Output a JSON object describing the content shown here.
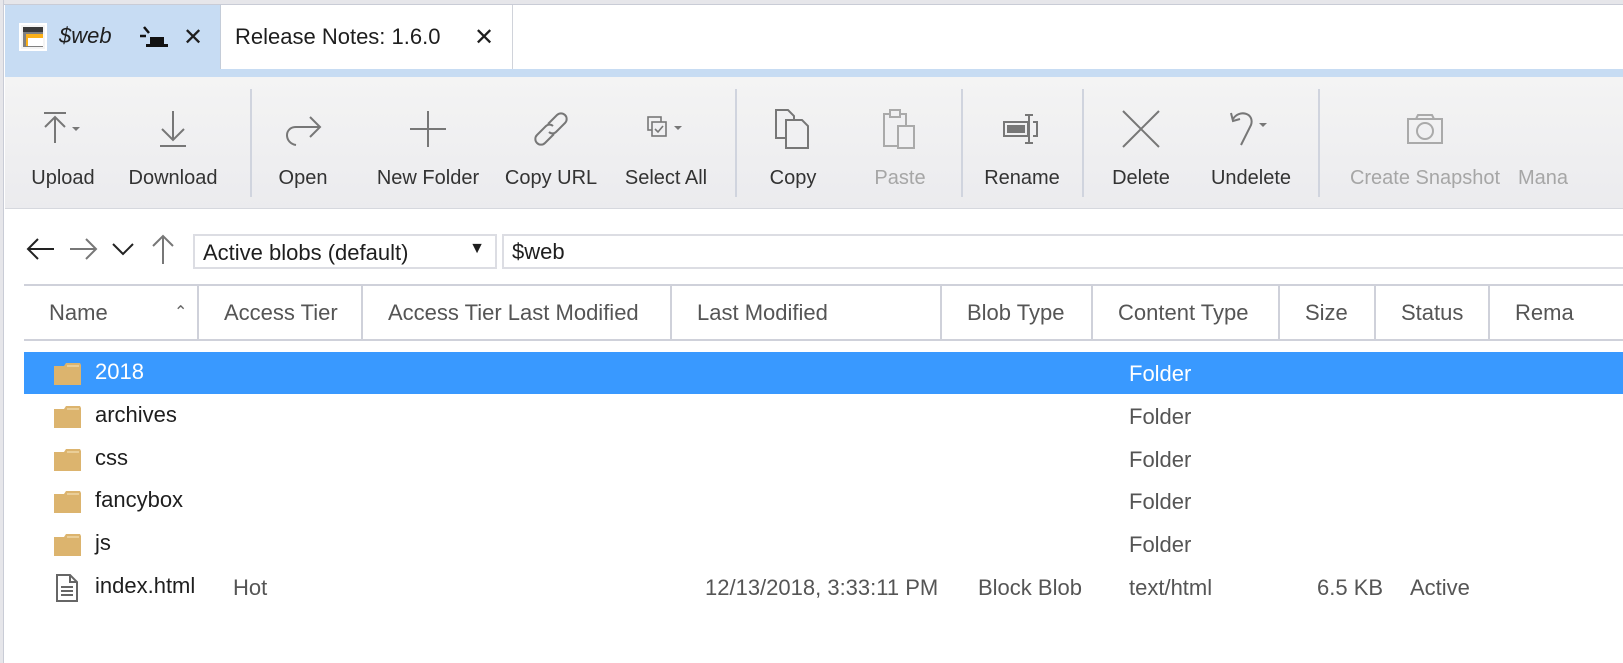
{
  "tabs": [
    {
      "title": "$web",
      "icon": "container-icon",
      "pinned": true,
      "active": true
    },
    {
      "title": "Release Notes: 1.6.0",
      "active": false
    }
  ],
  "toolbar": {
    "buttons": [
      {
        "label": "Upload",
        "icon": "upload-icon",
        "dropdown": true,
        "enabled": true
      },
      {
        "label": "Download",
        "icon": "download-icon",
        "enabled": true
      },
      {
        "label": "Open",
        "icon": "open-icon",
        "enabled": true
      },
      {
        "label": "New Folder",
        "icon": "plus-icon",
        "enabled": true
      },
      {
        "label": "Copy URL",
        "icon": "link-icon",
        "enabled": true
      },
      {
        "label": "Select All",
        "icon": "select-all-icon",
        "dropdown": true,
        "enabled": true
      },
      {
        "label": "Copy",
        "icon": "copy-icon",
        "enabled": true
      },
      {
        "label": "Paste",
        "icon": "paste-icon",
        "enabled": false
      },
      {
        "label": "Rename",
        "icon": "rename-icon",
        "enabled": true
      },
      {
        "label": "Delete",
        "icon": "delete-icon",
        "enabled": true
      },
      {
        "label": "Undelete",
        "icon": "undo-icon",
        "dropdown": true,
        "enabled": true
      },
      {
        "label": "Create Snapshot",
        "icon": "camera-icon",
        "enabled": false
      },
      {
        "label": "Mana",
        "icon": "",
        "enabled": false
      }
    ]
  },
  "navigation": {
    "back": "back-arrow-icon",
    "forward": "forward-arrow-icon",
    "recent": "chevron-down-icon",
    "up": "up-arrow-icon",
    "view_filter": "Active blobs (default)",
    "path": "$web"
  },
  "table": {
    "columns": [
      "Name",
      "Access Tier",
      "Access Tier Last Modified",
      "Last Modified",
      "Blob Type",
      "Content Type",
      "Size",
      "Status",
      "Rema"
    ],
    "sort_column": "Name",
    "sort_direction": "ascending",
    "rows": [
      {
        "name": "2018",
        "type": "folder",
        "access_tier": "",
        "last_modified": "",
        "blob_type": "",
        "content_type": "Folder",
        "size": "",
        "status": "",
        "selected": true
      },
      {
        "name": "archives",
        "type": "folder",
        "access_tier": "",
        "last_modified": "",
        "blob_type": "",
        "content_type": "Folder",
        "size": "",
        "status": ""
      },
      {
        "name": "css",
        "type": "folder",
        "access_tier": "",
        "last_modified": "",
        "blob_type": "",
        "content_type": "Folder",
        "size": "",
        "status": ""
      },
      {
        "name": "fancybox",
        "type": "folder",
        "access_tier": "",
        "last_modified": "",
        "blob_type": "",
        "content_type": "Folder",
        "size": "",
        "status": ""
      },
      {
        "name": "js",
        "type": "folder",
        "access_tier": "",
        "last_modified": "",
        "blob_type": "",
        "content_type": "Folder",
        "size": "",
        "status": ""
      },
      {
        "name": "index.html",
        "type": "file",
        "access_tier": "Hot",
        "last_modified": "12/13/2018, 3:33:11 PM",
        "blob_type": "Block Blob",
        "content_type": "text/html",
        "size": "6.5 KB",
        "status": "Active"
      }
    ]
  },
  "colors": {
    "tab_active_bg": "#c7dcf3",
    "selection": "#3999ff",
    "folder": "#dcb46e"
  }
}
